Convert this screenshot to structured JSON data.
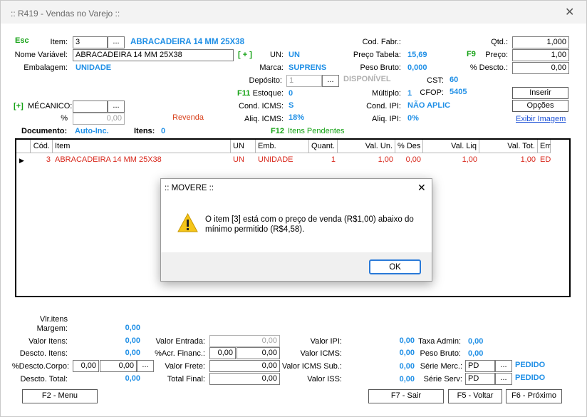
{
  "window": {
    "title": ":: R419 - Vendas no Varejo ::",
    "close": "✕"
  },
  "esc": "Esc",
  "item": {
    "label": "Item:",
    "code": "3",
    "dots": "...",
    "desc": "ABRACADEIRA 14 MM  25X38"
  },
  "nomevar": {
    "label": "Nome Variável:",
    "value": "ABRACADEIRA 14 MM  25X38",
    "plus": "[ + ]"
  },
  "embalagem": {
    "label": "Embalagem:",
    "value": "UNIDADE"
  },
  "mecanico": {
    "plus": "[+]",
    "label": "MÉCANICO:",
    "value": "",
    "dots": "...",
    "pct_label": "%",
    "pct_value": "0,00",
    "revenda": "Revenda"
  },
  "un": {
    "label": "UN:",
    "value": "UN"
  },
  "marca": {
    "label": "Marca:",
    "value": "SUPRENS"
  },
  "deposito": {
    "label": "Depósito:",
    "value": "1",
    "dots": "...",
    "status": "DISPONÍVEL"
  },
  "estoque": {
    "key": "F11",
    "label": "Estoque:",
    "value": "0"
  },
  "condicms": {
    "label": "Cond. ICMS:",
    "value": "S"
  },
  "aliqicms": {
    "label": "Aliq. ICMS:",
    "value": "18%"
  },
  "codfabr": {
    "label": "Cod. Fabr.:"
  },
  "precotab": {
    "label": "Preço Tabela:",
    "value": "15,69"
  },
  "pesobruto": {
    "label": "Peso Bruto:",
    "value": "0,000"
  },
  "cst": {
    "label": "CST:",
    "value": "60"
  },
  "multiplo": {
    "label": "Múltiplo:",
    "value": "1"
  },
  "cfop": {
    "label": "CFOP:",
    "value": "5405"
  },
  "condipi": {
    "label": "Cond. IPI:",
    "value": "NÃO APLIC"
  },
  "aliqipi": {
    "label": "Aliq. IPI:",
    "value": "0%"
  },
  "qtd": {
    "label": "Qtd.:",
    "value": "1,000"
  },
  "preco": {
    "key": "F9",
    "label": "Preço:",
    "value": "1,00"
  },
  "desconto": {
    "label": "% Descto.:",
    "value": "0,00"
  },
  "buttons": {
    "inserir": "Inserir",
    "opcoes": "Opções",
    "exibir": "Exibir Imagem"
  },
  "documento": {
    "label": "Documento:",
    "value": "Auto-Inc.",
    "itens_label": "Itens:",
    "itens_value": "0",
    "pendentes_key": "F12",
    "pendentes": "Itens Pendentes"
  },
  "grid": {
    "headers": [
      "Cód.",
      "Item",
      "UN",
      "Emb.",
      "Quant.",
      "Val. Un.",
      "% Des",
      "Val. Liq",
      "Val. Tot.",
      "Err"
    ],
    "rows": [
      {
        "cod": "3",
        "item": "ABRACADEIRA 14 MM  25X38",
        "un": "UN",
        "emb": "UNIDADE",
        "quant": "1",
        "valun": "1,00",
        "des": "0,00",
        "valliq": "1,00",
        "valtot": "1,00",
        "err": "ED"
      }
    ]
  },
  "dialog": {
    "title": ":: MOVERE ::",
    "close": "✕",
    "message1": "O item [3] está com o preço de venda (R$1,00) abaixo do",
    "message2": "mínimo permitido (R$4,58).",
    "ok": "OK"
  },
  "totals": {
    "vlritens": "Vlr.itens",
    "margem_label": "Margem:",
    "margem": "0,00",
    "valoritens_label": "Valor Itens:",
    "valoritens": "0,00",
    "desctoitens_label": "Descto. Itens:",
    "desctoitens": "0,00",
    "desctocorpo_label": "%Descto.Corpo:",
    "desctocorpo1": "0,00",
    "desctocorpo2": "0,00",
    "dots": "...",
    "desctototal_label": "Descto. Total:",
    "desctototal": "0,00",
    "valorentrada_label": "Valor Entrada:",
    "valorentrada": "0,00",
    "acrfinanc_label": "%Acr. Financ.:",
    "acrfinanc1": "0,00",
    "acrfinanc2": "0,00",
    "valorfrete_label": "Valor Frete:",
    "valorfrete": "0,00",
    "totalfinal_label": "Total Final:",
    "totalfinal": "0,00",
    "valoripi_label": "Valor IPI:",
    "valoripi": "0,00",
    "valoricms_label": "Valor ICMS:",
    "valoricms": "0,00",
    "valoricmssub_label": "Valor ICMS Sub.:",
    "valoricmssub": "0,00",
    "valoriss_label": "Valor ISS:",
    "valoriss": "0,00",
    "taxaadmin_label": "Taxa Admin:",
    "taxaadmin": "0,00",
    "pesobruto_label": "Peso Bruto:",
    "pesobruto": "0,00",
    "seriemerc_label": "Série Merc.:",
    "seriemerc": "PD",
    "seriemerc_status": "PEDIDO",
    "serieserv_label": "Série Serv:",
    "serieserv": "PD",
    "serieserv_status": "PEDIDO"
  },
  "footer": {
    "f2": "F2 - Menu",
    "f7": "F7 - Sair",
    "f5": "F5 - Voltar",
    "f6": "F6 - Próximo"
  }
}
